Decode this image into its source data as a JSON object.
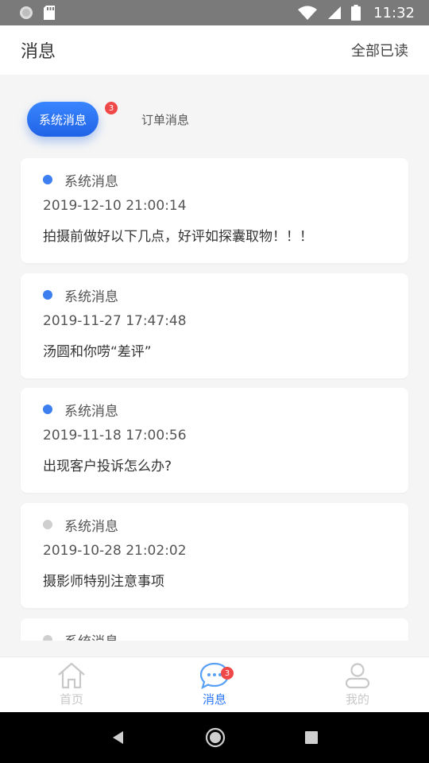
{
  "status_bar": {
    "time": "11:32"
  },
  "header": {
    "title": "消息",
    "read_all": "全部已读"
  },
  "tabs": {
    "active_label": "系统消息",
    "badge": "3",
    "inactive_label": "订单消息"
  },
  "messages": [
    {
      "title": "系统消息",
      "time": "2019-12-10 21:00:14",
      "text": "拍摄前做好以下几点，好评如探囊取物！！！"
    },
    {
      "title": "系统消息",
      "time": "2019-11-27 17:47:48",
      "text": "汤圆和你唠“差评”"
    },
    {
      "title": "系统消息",
      "time": "2019-11-18 17:00:56",
      "text": "出现客户投诉怎么办?"
    },
    {
      "title": "系统消息",
      "time": "2019-10-28 21:02:02",
      "text": "摄影师特别注意事项"
    },
    {
      "title": "系统消息"
    }
  ],
  "tabbar": {
    "home": "首页",
    "messages": "消息",
    "messages_badge": "3",
    "mine": "我的"
  },
  "colors": {
    "accent": "#2f78f5",
    "unread_dot": "#3d7ff0",
    "read_dot": "#cfcfcf",
    "badge": "#f04848",
    "inactive_icon": "#c8c8c8"
  }
}
